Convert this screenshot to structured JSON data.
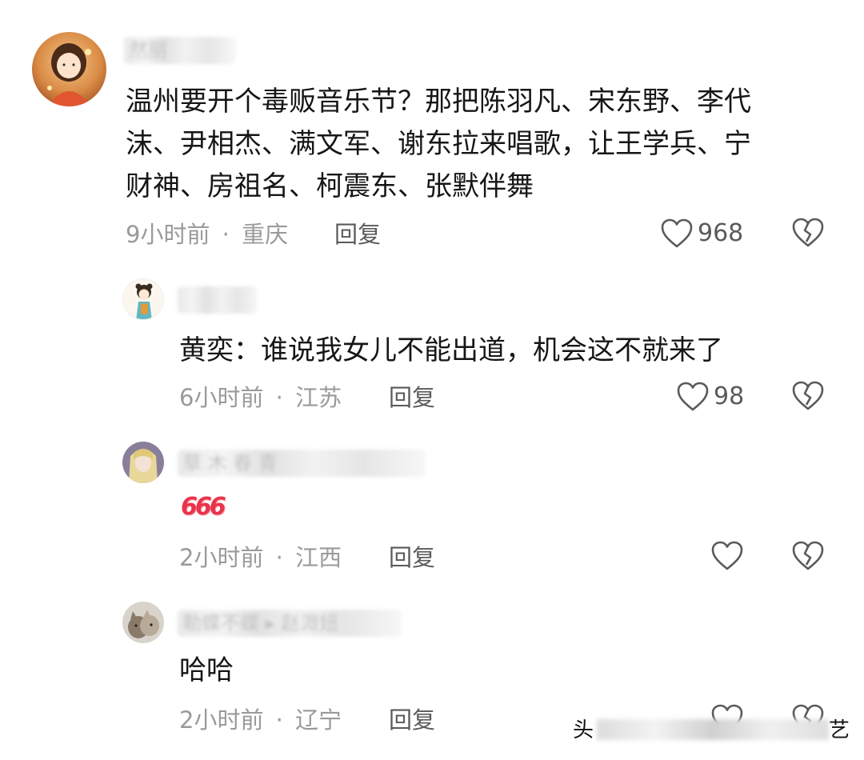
{
  "comments": [
    {
      "text_lines": [
        "温州要开个毒贩音乐节？那把陈羽凡、宋东野、李代",
        "沫、尹相杰、满文军、谢东拉来唱歌，让王学兵、宁",
        "财神、房祖名、柯震东、张默伴舞"
      ],
      "time": "9小时前",
      "location": "重庆",
      "reply_label": "回复",
      "likes": "968"
    },
    {
      "text": "黄奕：谁说我女儿不能出道，机会这不就来了",
      "time": "6小时前",
      "location": "江苏",
      "reply_label": "回复",
      "likes": "98"
    },
    {
      "text": "666",
      "time": "2小时前",
      "location": "江西",
      "reply_label": "回复",
      "likes": ""
    },
    {
      "text": "哈哈",
      "time": "2小时前",
      "location": "辽宁",
      "reply_label": "回复",
      "likes": ""
    }
  ],
  "separator": "·",
  "watermark": {
    "text_left": "头",
    "text_right": "艺"
  },
  "icons": {
    "like": "heart-outline-icon",
    "dislike": "broken-heart-icon"
  },
  "colors": {
    "meta": "#9a9a9a",
    "reply": "#5a5a5a",
    "emoji": "#e8344a"
  }
}
